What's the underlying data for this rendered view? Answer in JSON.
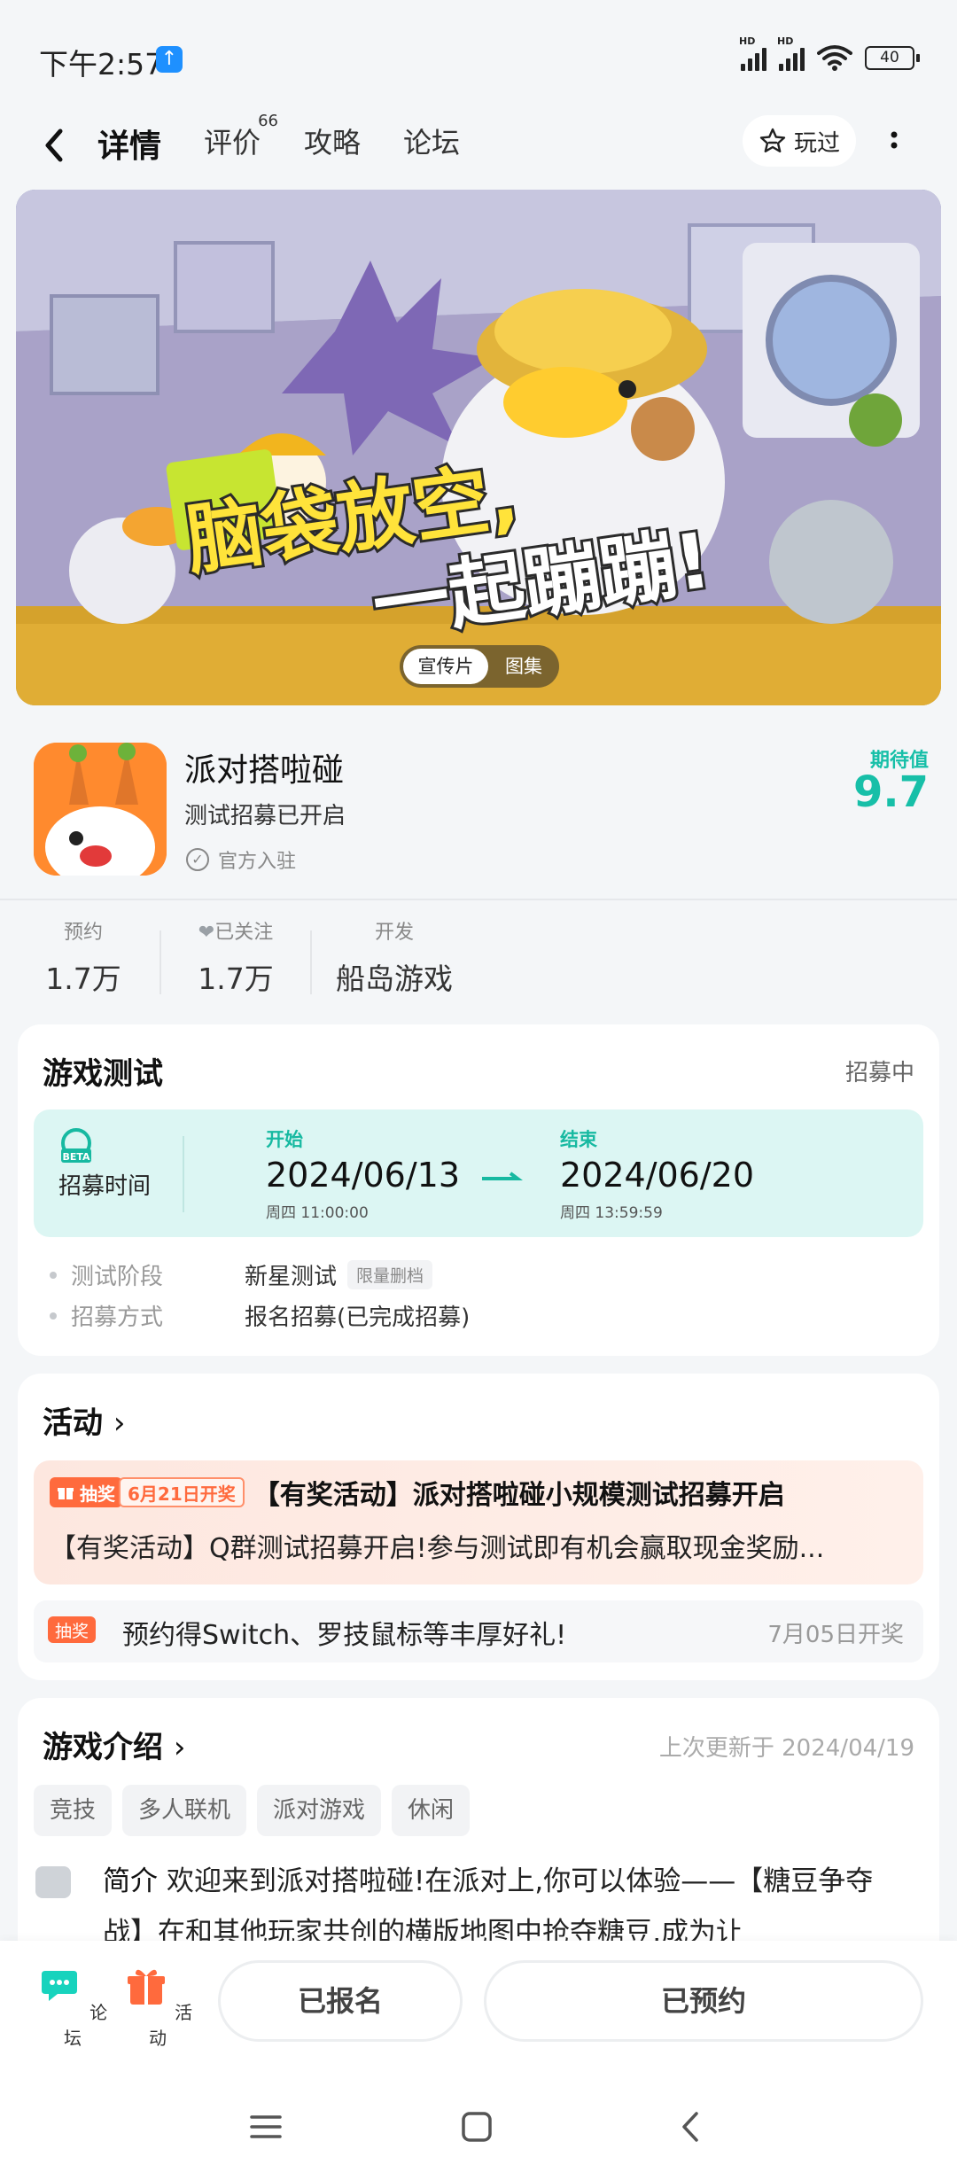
{
  "status_bar": {
    "time": "下午2:57",
    "battery": "40"
  },
  "nav": {
    "tabs": [
      {
        "label": "详情",
        "badge": ""
      },
      {
        "label": "评价",
        "badge": "66"
      },
      {
        "label": "攻略",
        "badge": ""
      },
      {
        "label": "论坛",
        "badge": ""
      }
    ],
    "played_label": "玩过"
  },
  "banner": {
    "headline_1": "脑袋放空,",
    "headline_2": "一起蹦蹦!",
    "media_tabs": [
      "宣传片",
      "图集"
    ]
  },
  "game": {
    "name": "派对搭啦碰",
    "subtitle": "测试招募已开启",
    "official": "官方入驻",
    "expect_label": "期待值",
    "expect_value": "9.7"
  },
  "stats": [
    {
      "label": "预约",
      "value": "1.7万"
    },
    {
      "label": "已关注",
      "value": "1.7万"
    },
    {
      "label": "开发",
      "value": "船岛游戏"
    }
  ],
  "test_card": {
    "title": "游戏测试",
    "status": "招募中",
    "recruit_label": "招募时间",
    "start_key": "开始",
    "start_date": "2024/06/13",
    "start_weekday": "周四  11:00:00",
    "end_key": "结束",
    "end_date": "2024/06/20",
    "end_weekday": "周四  13:59:59",
    "rows": [
      {
        "key": "测试阶段",
        "value": "新星测试",
        "tag": "限量删档"
      },
      {
        "key": "招募方式",
        "value": "报名招募(已完成招募)",
        "tag": ""
      }
    ]
  },
  "activity_card": {
    "title": "活动",
    "main": {
      "tag": "抽奖",
      "date_tag": "6月21日开奖",
      "title": "【有奖活动】派对搭啦碰小规模测试招募开启",
      "desc": "【有奖活动】Q群测试招募开启!参与测试即有机会赢取现金奖励..."
    },
    "sub": {
      "tag": "抽奖",
      "text": "预约得Switch、罗技鼠标等丰厚好礼!",
      "when": "7月05日开奖"
    }
  },
  "intro_card": {
    "title": "游戏介绍",
    "updated": "上次更新于 2024/04/19",
    "tags": [
      "竞技",
      "多人联机",
      "派对游戏",
      "休闲"
    ],
    "intro_label": "简介",
    "intro_text": "欢迎来到派对搭啦碰!在派对上,你可以体验——【糖豆争夺战】在和其他玩家共创的横版地图中抢夺糖豆,成为让"
  },
  "bottom_bar": {
    "forum_label": "论坛",
    "activity_label": "活动",
    "signed_up": "已报名",
    "reserved": "已预约"
  },
  "colors": {
    "accent": "#17d3bd",
    "lottery": "#ff6a3d"
  }
}
